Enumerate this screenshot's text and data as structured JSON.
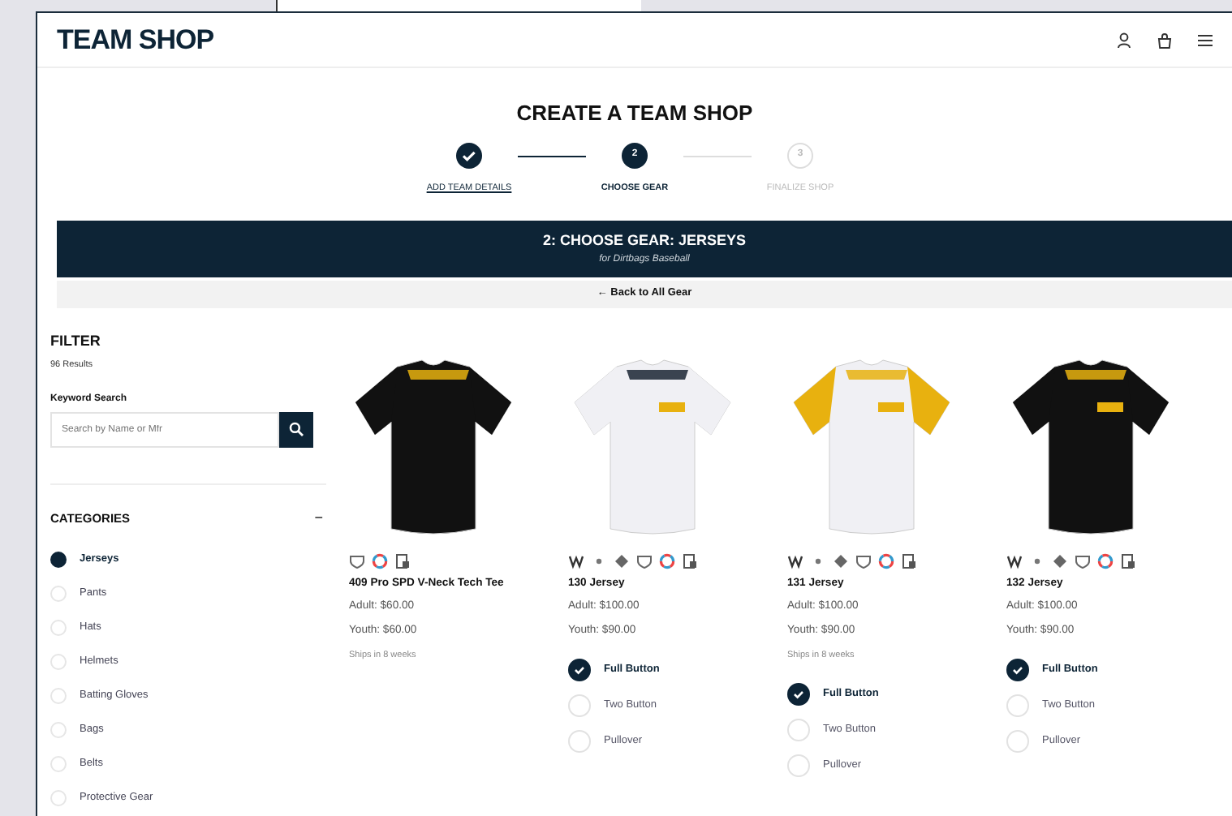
{
  "header": {
    "logo": "TEAM SHOP"
  },
  "page_title": "CREATE A TEAM SHOP",
  "steps": [
    {
      "label": "ADD TEAM DETAILS",
      "done": true,
      "selected": false
    },
    {
      "marker": "2",
      "label": "CHOOSE GEAR",
      "done": false,
      "selected": true
    },
    {
      "marker": "3",
      "label": "FINALIZE SHOP",
      "done": false,
      "selected": false
    }
  ],
  "banner": {
    "title": "2: CHOOSE GEAR: JERSEYS",
    "subtitle": "for Dirtbags Baseball"
  },
  "back_link": "← Back to All Gear",
  "filter": {
    "title": "FILTER",
    "results": "96 Results",
    "search_label": "Keyword Search",
    "placeholder": "Search by Name or Mfr",
    "categories_title": "CATEGORIES",
    "toggle": "−",
    "categories": [
      {
        "label": "Jerseys",
        "selected": true
      },
      {
        "label": "Pants",
        "selected": false
      },
      {
        "label": "Hats",
        "selected": false
      },
      {
        "label": "Helmets",
        "selected": false
      },
      {
        "label": "Batting Gloves",
        "selected": false
      },
      {
        "label": "Bags",
        "selected": false
      },
      {
        "label": "Belts",
        "selected": false
      },
      {
        "label": "Protective Gear",
        "selected": false
      }
    ]
  },
  "products": [
    {
      "kind": "tee",
      "features": [
        {
          "kind": "shield"
        },
        {
          "kind": "wheel"
        },
        {
          "kind": "doc"
        }
      ],
      "name": "409 Pro SPD V-Neck Tech Tee",
      "adult": "Adult: $60.00",
      "youth": "Youth: $60.00",
      "ships": "Ships in 8 weeks"
    },
    {
      "kind": "white",
      "features": [
        {
          "kind": "logo"
        },
        {
          "kind": "dot"
        },
        {
          "kind": "diamond"
        },
        {
          "kind": "shield"
        },
        {
          "kind": "wheel"
        },
        {
          "kind": "doc"
        }
      ],
      "name": "130 Jersey",
      "adult": "Adult: $100.00",
      "youth": "Youth: $90.00",
      "options": [
        {
          "label": "Full Button",
          "selected": true
        },
        {
          "label": "Two Button",
          "selected": false
        },
        {
          "label": "Pullover",
          "selected": false
        }
      ]
    },
    {
      "kind": "gold",
      "features": [
        {
          "kind": "logo"
        },
        {
          "kind": "dot"
        },
        {
          "kind": "diamond"
        },
        {
          "kind": "shield"
        },
        {
          "kind": "wheel"
        },
        {
          "kind": "doc"
        }
      ],
      "name": "131 Jersey",
      "adult": "Adult: $100.00",
      "youth": "Youth: $90.00",
      "ships": "Ships in 8 weeks",
      "options": [
        {
          "label": "Full Button",
          "selected": true
        },
        {
          "label": "Two Button",
          "selected": false
        },
        {
          "label": "Pullover",
          "selected": false
        }
      ]
    },
    {
      "kind": "black",
      "features": [
        {
          "kind": "logo"
        },
        {
          "kind": "dot"
        },
        {
          "kind": "diamond"
        },
        {
          "kind": "shield"
        },
        {
          "kind": "wheel"
        },
        {
          "kind": "doc"
        }
      ],
      "name": "132 Jersey",
      "adult": "Adult: $100.00",
      "youth": "Youth: $90.00",
      "options": [
        {
          "label": "Full Button",
          "selected": true
        },
        {
          "label": "Two Button",
          "selected": false
        },
        {
          "label": "Pullover",
          "selected": false
        }
      ]
    }
  ]
}
